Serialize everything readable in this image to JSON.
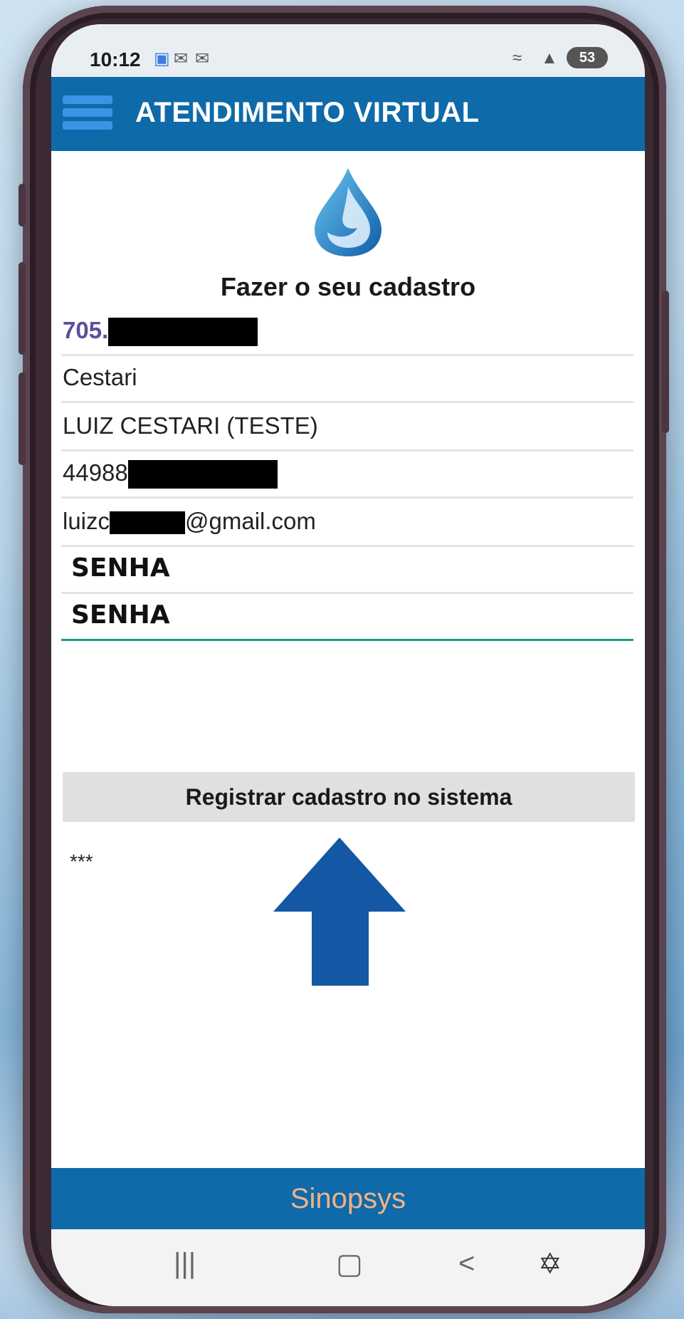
{
  "status_bar": {
    "time": "10:12",
    "battery": "53"
  },
  "header": {
    "title": "ATENDIMENTO VIRTUAL"
  },
  "page": {
    "title": "Fazer o seu cadastro"
  },
  "form": {
    "cpf_prefix": "705.",
    "surname": "Cestari",
    "full_name": "LUIZ CESTARI (TESTE)",
    "phone_prefix": "44988",
    "email_prefix": "luizc",
    "email_suffix": "@gmail.com",
    "password_placeholder": "SENHA",
    "password_confirm_placeholder": "SENHA"
  },
  "register_button": {
    "label": "Registrar cadastro no sistema"
  },
  "note": "***",
  "footer": {
    "brand": "Sinopsys"
  },
  "colors": {
    "header": "#0e6aa8",
    "accent_line": "#1a9b8a",
    "arrow": "#1457a5",
    "footer_text": "#f2b189"
  }
}
